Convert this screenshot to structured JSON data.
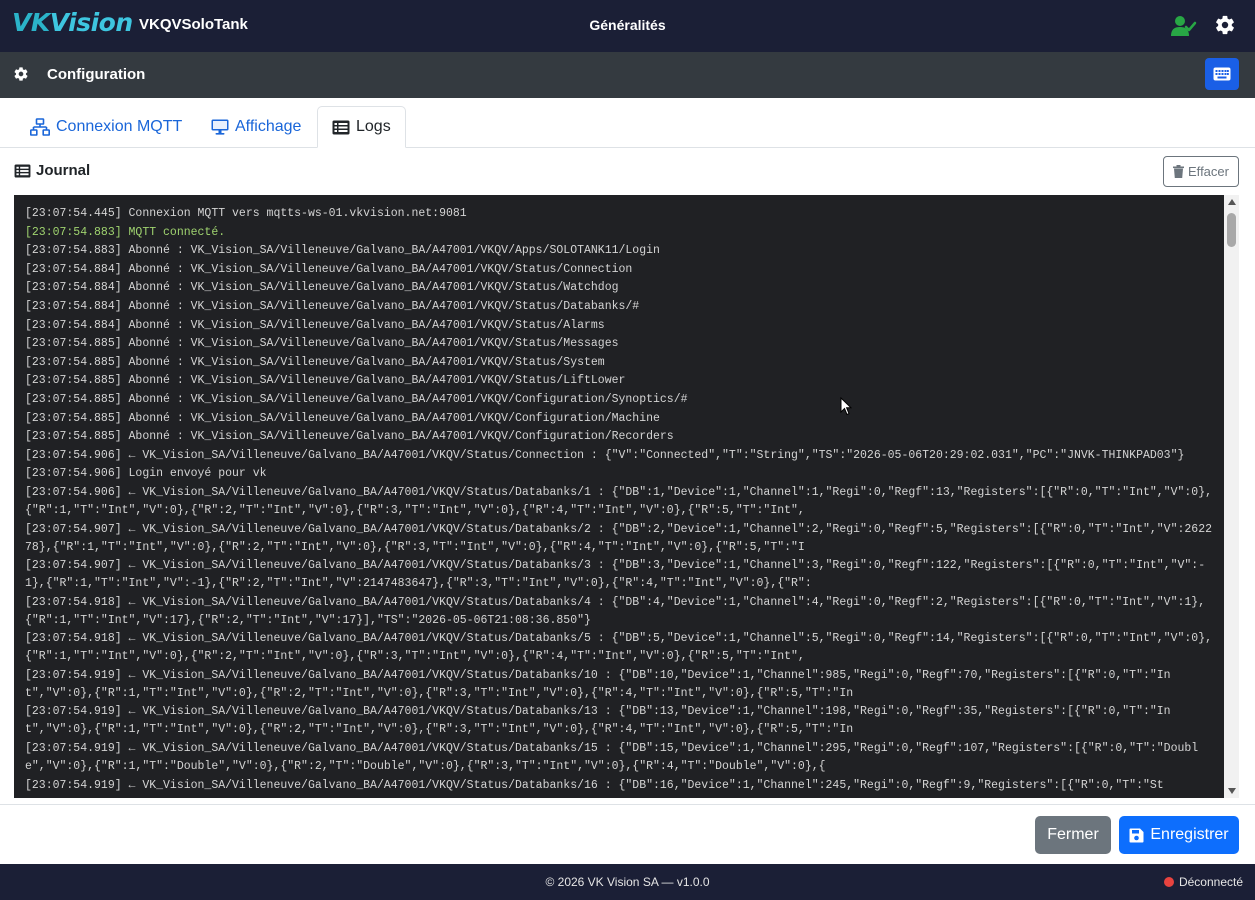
{
  "header": {
    "logo": {
      "part1": "VK",
      "part2": "Vision"
    },
    "app_name": "VKQVSoloTank",
    "title": "Généralités",
    "icons": {
      "user": "user-check-icon",
      "settings": "gear-icon"
    },
    "colors": {
      "background": "#1b1f36",
      "logo": "#2bb3c9",
      "user_icon": "#28a745"
    }
  },
  "config_bar": {
    "title": "Configuration",
    "icon": "gear-icon",
    "keyboard_icon": "keyboard-icon",
    "colors": {
      "background": "#343a40",
      "keyboard_button": "#1a5fe6"
    }
  },
  "tabs": [
    {
      "label": "Connexion MQTT",
      "icon": "network-icon",
      "active": false
    },
    {
      "label": "Affichage",
      "icon": "monitor-icon",
      "active": false
    },
    {
      "label": "Logs",
      "icon": "list-icon",
      "active": true
    }
  ],
  "journal": {
    "title": "Journal",
    "icon": "list-icon",
    "clear_label": "Effacer",
    "clear_icon": "trash-icon",
    "lines": [
      {
        "text": "[23:07:54.445] Connexion MQTT vers mqtts-ws-01.vkvision.net:9081",
        "kind": "info"
      },
      {
        "text": "[23:07:54.883] MQTT connecté.",
        "kind": "ok"
      },
      {
        "text": "[23:07:54.883] Abonné : VK_Vision_SA/Villeneuve/Galvano_BA/A47001/VKQV/Apps/SOLOTANK11/Login",
        "kind": "info"
      },
      {
        "text": "[23:07:54.884] Abonné : VK_Vision_SA/Villeneuve/Galvano_BA/A47001/VKQV/Status/Connection",
        "kind": "info"
      },
      {
        "text": "[23:07:54.884] Abonné : VK_Vision_SA/Villeneuve/Galvano_BA/A47001/VKQV/Status/Watchdog",
        "kind": "info"
      },
      {
        "text": "[23:07:54.884] Abonné : VK_Vision_SA/Villeneuve/Galvano_BA/A47001/VKQV/Status/Databanks/#",
        "kind": "info"
      },
      {
        "text": "[23:07:54.884] Abonné : VK_Vision_SA/Villeneuve/Galvano_BA/A47001/VKQV/Status/Alarms",
        "kind": "info"
      },
      {
        "text": "[23:07:54.885] Abonné : VK_Vision_SA/Villeneuve/Galvano_BA/A47001/VKQV/Status/Messages",
        "kind": "info"
      },
      {
        "text": "[23:07:54.885] Abonné : VK_Vision_SA/Villeneuve/Galvano_BA/A47001/VKQV/Status/System",
        "kind": "info"
      },
      {
        "text": "[23:07:54.885] Abonné : VK_Vision_SA/Villeneuve/Galvano_BA/A47001/VKQV/Status/LiftLower",
        "kind": "info"
      },
      {
        "text": "[23:07:54.885] Abonné : VK_Vision_SA/Villeneuve/Galvano_BA/A47001/VKQV/Configuration/Synoptics/#",
        "kind": "info"
      },
      {
        "text": "[23:07:54.885] Abonné : VK_Vision_SA/Villeneuve/Galvano_BA/A47001/VKQV/Configuration/Machine",
        "kind": "info"
      },
      {
        "text": "[23:07:54.885] Abonné : VK_Vision_SA/Villeneuve/Galvano_BA/A47001/VKQV/Configuration/Recorders",
        "kind": "info"
      },
      {
        "text": "[23:07:54.906] ← VK_Vision_SA/Villeneuve/Galvano_BA/A47001/VKQV/Status/Connection : {\"V\":\"Connected\",\"T\":\"String\",\"TS\":\"2026-05-06T20:29:02.031\",\"PC\":\"JNVK-THINKPAD03\"}",
        "kind": "info"
      },
      {
        "text": "[23:07:54.906] Login envoyé pour vk",
        "kind": "info"
      },
      {
        "text": "[23:07:54.906] ← VK_Vision_SA/Villeneuve/Galvano_BA/A47001/VKQV/Status/Databanks/1 : {\"DB\":1,\"Device\":1,\"Channel\":1,\"Regi\":0,\"Regf\":13,\"Registers\":[{\"R\":0,\"T\":\"Int\",\"V\":0},{\"R\":1,\"T\":\"Int\",\"V\":0},{\"R\":2,\"T\":\"Int\",\"V\":0},{\"R\":3,\"T\":\"Int\",\"V\":0},{\"R\":4,\"T\":\"Int\",\"V\":0},{\"R\":5,\"T\":\"Int\",",
        "kind": "info"
      },
      {
        "text": "[23:07:54.907] ← VK_Vision_SA/Villeneuve/Galvano_BA/A47001/VKQV/Status/Databanks/2 : {\"DB\":2,\"Device\":1,\"Channel\":2,\"Regi\":0,\"Regf\":5,\"Registers\":[{\"R\":0,\"T\":\"Int\",\"V\":262278},{\"R\":1,\"T\":\"Int\",\"V\":0},{\"R\":2,\"T\":\"Int\",\"V\":0},{\"R\":3,\"T\":\"Int\",\"V\":0},{\"R\":4,\"T\":\"Int\",\"V\":0},{\"R\":5,\"T\":\"I",
        "kind": "info"
      },
      {
        "text": "[23:07:54.907] ← VK_Vision_SA/Villeneuve/Galvano_BA/A47001/VKQV/Status/Databanks/3 : {\"DB\":3,\"Device\":1,\"Channel\":3,\"Regi\":0,\"Regf\":122,\"Registers\":[{\"R\":0,\"T\":\"Int\",\"V\":-1},{\"R\":1,\"T\":\"Int\",\"V\":-1},{\"R\":2,\"T\":\"Int\",\"V\":2147483647},{\"R\":3,\"T\":\"Int\",\"V\":0},{\"R\":4,\"T\":\"Int\",\"V\":0},{\"R\":",
        "kind": "info"
      },
      {
        "text": "[23:07:54.918] ← VK_Vision_SA/Villeneuve/Galvano_BA/A47001/VKQV/Status/Databanks/4 : {\"DB\":4,\"Device\":1,\"Channel\":4,\"Regi\":0,\"Regf\":2,\"Registers\":[{\"R\":0,\"T\":\"Int\",\"V\":1},{\"R\":1,\"T\":\"Int\",\"V\":17},{\"R\":2,\"T\":\"Int\",\"V\":17}],\"TS\":\"2026-05-06T21:08:36.850\"}",
        "kind": "info"
      },
      {
        "text": "[23:07:54.918] ← VK_Vision_SA/Villeneuve/Galvano_BA/A47001/VKQV/Status/Databanks/5 : {\"DB\":5,\"Device\":1,\"Channel\":5,\"Regi\":0,\"Regf\":14,\"Registers\":[{\"R\":0,\"T\":\"Int\",\"V\":0},{\"R\":1,\"T\":\"Int\",\"V\":0},{\"R\":2,\"T\":\"Int\",\"V\":0},{\"R\":3,\"T\":\"Int\",\"V\":0},{\"R\":4,\"T\":\"Int\",\"V\":0},{\"R\":5,\"T\":\"Int\",",
        "kind": "info"
      },
      {
        "text": "[23:07:54.919] ← VK_Vision_SA/Villeneuve/Galvano_BA/A47001/VKQV/Status/Databanks/10 : {\"DB\":10,\"Device\":1,\"Channel\":985,\"Regi\":0,\"Regf\":70,\"Registers\":[{\"R\":0,\"T\":\"Int\",\"V\":0},{\"R\":1,\"T\":\"Int\",\"V\":0},{\"R\":2,\"T\":\"Int\",\"V\":0},{\"R\":3,\"T\":\"Int\",\"V\":0},{\"R\":4,\"T\":\"Int\",\"V\":0},{\"R\":5,\"T\":\"In",
        "kind": "info"
      },
      {
        "text": "[23:07:54.919] ← VK_Vision_SA/Villeneuve/Galvano_BA/A47001/VKQV/Status/Databanks/13 : {\"DB\":13,\"Device\":1,\"Channel\":198,\"Regi\":0,\"Regf\":35,\"Registers\":[{\"R\":0,\"T\":\"Int\",\"V\":0},{\"R\":1,\"T\":\"Int\",\"V\":0},{\"R\":2,\"T\":\"Int\",\"V\":0},{\"R\":3,\"T\":\"Int\",\"V\":0},{\"R\":4,\"T\":\"Int\",\"V\":0},{\"R\":5,\"T\":\"In",
        "kind": "info"
      },
      {
        "text": "[23:07:54.919] ← VK_Vision_SA/Villeneuve/Galvano_BA/A47001/VKQV/Status/Databanks/15 : {\"DB\":15,\"Device\":1,\"Channel\":295,\"Regi\":0,\"Regf\":107,\"Registers\":[{\"R\":0,\"T\":\"Double\",\"V\":0},{\"R\":1,\"T\":\"Double\",\"V\":0},{\"R\":2,\"T\":\"Double\",\"V\":0},{\"R\":3,\"T\":\"Int\",\"V\":0},{\"R\":4,\"T\":\"Double\",\"V\":0},{",
        "kind": "info"
      },
      {
        "text": "[23:07:54.919] ← VK_Vision_SA/Villeneuve/Galvano_BA/A47001/VKQV/Status/Databanks/16 : {\"DB\":16,\"Device\":1,\"Channel\":245,\"Regi\":0,\"Regf\":9,\"Registers\":[{\"R\":0,\"T\":\"St",
        "kind": "info"
      }
    ],
    "colors": {
      "background": "#202124",
      "text": "#d4d4d4",
      "ok": "#9fd36f"
    }
  },
  "actions": {
    "close_label": "Fermer",
    "save_label": "Enregistrer",
    "save_icon": "save-icon",
    "colors": {
      "close": "#6c757d",
      "save": "#0d6efd"
    }
  },
  "status_bar": {
    "copyright": "© 2026 VK Vision SA — v1.0.0",
    "connection": "Déconnecté",
    "colors": {
      "dot": "#e8433f"
    }
  }
}
